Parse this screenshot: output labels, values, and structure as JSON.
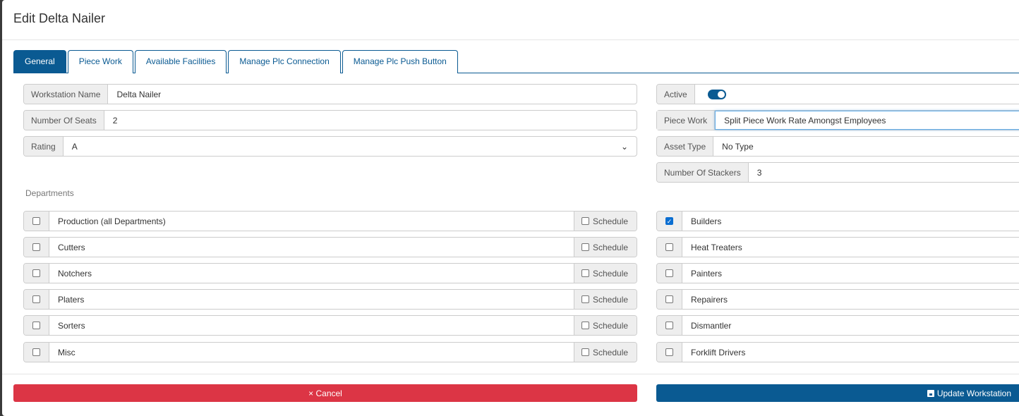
{
  "title": "Edit Delta Nailer",
  "tabs": [
    "General",
    "Piece Work",
    "Available Facilities",
    "Manage Plc Connection",
    "Manage Plc Push Button"
  ],
  "fields": {
    "workstation_name": {
      "label": "Workstation Name",
      "value": "Delta Nailer"
    },
    "number_of_seats": {
      "label": "Number Of Seats",
      "value": "2"
    },
    "rating": {
      "label": "Rating",
      "value": "A"
    },
    "active": {
      "label": "Active",
      "value": true
    },
    "piece_work": {
      "label": "Piece Work",
      "value": "Split Piece Work Rate Amongst Employees"
    },
    "asset_type": {
      "label": "Asset Type",
      "value": "No Type"
    },
    "number_of_stackers": {
      "label": "Number Of Stackers",
      "value": "3"
    }
  },
  "departments_label": "Departments",
  "schedule_label": "Schedule",
  "departments_left": [
    {
      "name": "Production (all Departments)",
      "checked": false,
      "schedule": false
    },
    {
      "name": "Cutters",
      "checked": false,
      "schedule": false
    },
    {
      "name": "Notchers",
      "checked": false,
      "schedule": false
    },
    {
      "name": "Platers",
      "checked": false,
      "schedule": false
    },
    {
      "name": "Sorters",
      "checked": false,
      "schedule": false
    },
    {
      "name": "Misc",
      "checked": false,
      "schedule": false
    }
  ],
  "departments_right": [
    {
      "name": "Builders",
      "checked": true
    },
    {
      "name": "Heat Treaters",
      "checked": false
    },
    {
      "name": "Painters",
      "checked": false
    },
    {
      "name": "Repairers",
      "checked": false
    },
    {
      "name": "Dismantler",
      "checked": false
    },
    {
      "name": "Forklift Drivers",
      "checked": false
    }
  ],
  "buttons": {
    "cancel": "× Cancel",
    "update": "Update Workstation"
  },
  "colors": {
    "primary": "#0a5a92",
    "danger": "#dc3545"
  }
}
